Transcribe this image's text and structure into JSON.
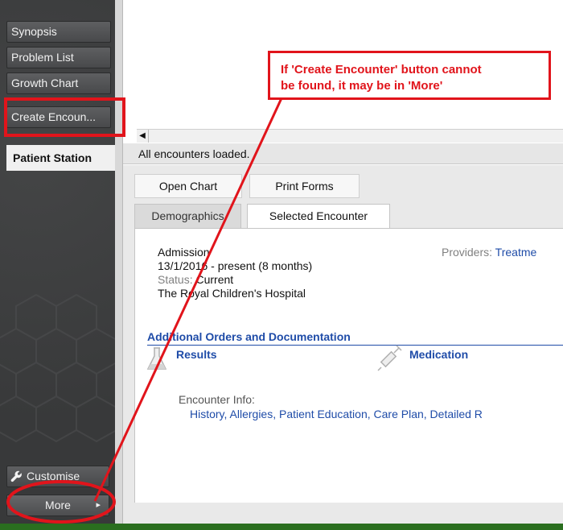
{
  "sidebar": {
    "items": [
      {
        "label": "Synopsis"
      },
      {
        "label": "Problem List"
      },
      {
        "label": "Growth Chart"
      },
      {
        "label": "Create Encoun..."
      }
    ],
    "active_label": "Patient Station",
    "customise_label": "Customise",
    "more_label": "More",
    "more_arrow": "▸"
  },
  "status": "All encounters loaded.",
  "scroll_arrow": "◀",
  "actions": {
    "open_chart": "Open Chart",
    "print_forms": "Print Forms"
  },
  "tabs": [
    {
      "label": "Demographics",
      "active": false
    },
    {
      "label": "Selected Encounter",
      "active": true
    }
  ],
  "encounter": {
    "type": "Admission",
    "dates": "13/1/2016 - present (8 months)",
    "status_label": "Status:",
    "status_value": "Current",
    "hospital": "The Royal Children's Hospital",
    "providers_label": "Providers:",
    "providers_value": "Treatme"
  },
  "orders": {
    "heading": "Additional Orders and Documentation",
    "results_label": "Results",
    "medication_label": "Medication"
  },
  "encounter_info": {
    "label": "Encounter Info:",
    "links": "History, Allergies, Patient Education, Care Plan, Detailed R"
  },
  "annotation": {
    "text": "If 'Create Encounter' button cannot\nbe found, it may be in 'More'",
    "color": "#e1141b"
  },
  "colors": {
    "link": "#1f4ca8",
    "sidebar": "#3a3b3c",
    "footer": "#2a6e1f"
  },
  "icons": [
    "wrench-icon",
    "flask-icon",
    "syringe-icon",
    "chevron-right-icon",
    "scroll-left-icon"
  ]
}
